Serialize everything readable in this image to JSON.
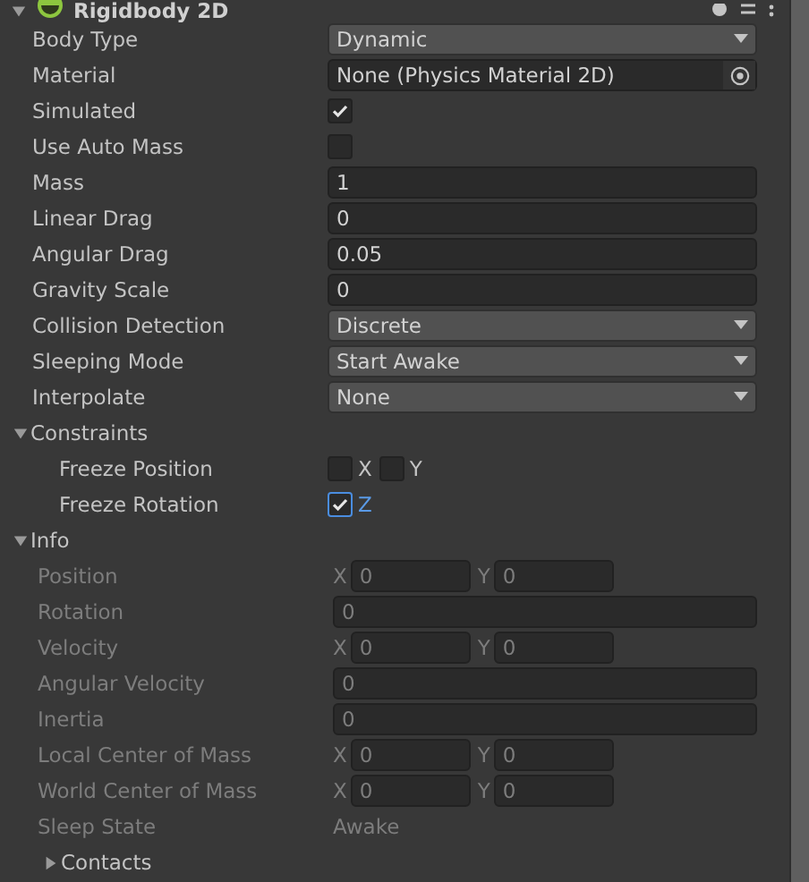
{
  "component": {
    "title": "Rigidbody 2D",
    "expanded": true
  },
  "properties": [
    {
      "kind": "dropdown",
      "label": "Body Type",
      "value": "Dynamic"
    },
    {
      "kind": "object",
      "label": "Material",
      "value": "None (Physics Material 2D)"
    },
    {
      "kind": "checkbox",
      "label": "Simulated",
      "checked": true
    },
    {
      "kind": "checkbox",
      "label": "Use Auto Mass",
      "checked": false
    },
    {
      "kind": "number",
      "label": "Mass",
      "value": "1"
    },
    {
      "kind": "number",
      "label": "Linear Drag",
      "value": "0"
    },
    {
      "kind": "number",
      "label": "Angular Drag",
      "value": "0.05"
    },
    {
      "kind": "number",
      "label": "Gravity Scale",
      "value": "0"
    },
    {
      "kind": "dropdown",
      "label": "Collision Detection",
      "value": "Discrete"
    },
    {
      "kind": "dropdown",
      "label": "Sleeping Mode",
      "value": "Start Awake"
    },
    {
      "kind": "dropdown",
      "label": "Interpolate",
      "value": "None"
    }
  ],
  "constraints": {
    "label": "Constraints",
    "expanded": true,
    "rows": [
      {
        "label": "Freeze Position",
        "axes": [
          {
            "axis": "X",
            "checked": false
          },
          {
            "axis": "Y",
            "checked": false
          }
        ]
      },
      {
        "label": "Freeze Rotation",
        "axes": [
          {
            "axis": "Z",
            "checked": true
          }
        ]
      }
    ]
  },
  "info": {
    "label": "Info",
    "expanded": true,
    "rows": [
      {
        "kind": "vector",
        "label": "Position",
        "fields": [
          {
            "axis": "X",
            "value": "0"
          },
          {
            "axis": "Y",
            "value": "0"
          }
        ]
      },
      {
        "kind": "number",
        "label": "Rotation",
        "value": "0"
      },
      {
        "kind": "vector",
        "label": "Velocity",
        "fields": [
          {
            "axis": "X",
            "value": "0"
          },
          {
            "axis": "Y",
            "value": "0"
          }
        ]
      },
      {
        "kind": "number",
        "label": "Angular Velocity",
        "value": "0"
      },
      {
        "kind": "number",
        "label": "Inertia",
        "value": "0"
      },
      {
        "kind": "vector",
        "label": "Local Center of Mass",
        "fields": [
          {
            "axis": "X",
            "value": "0"
          },
          {
            "axis": "Y",
            "value": "0"
          }
        ]
      },
      {
        "kind": "vector",
        "label": "World Center of Mass",
        "fields": [
          {
            "axis": "X",
            "value": "0"
          },
          {
            "axis": "Y",
            "value": "0"
          }
        ]
      },
      {
        "kind": "text",
        "label": "Sleep State",
        "value": "Awake"
      }
    ],
    "contacts": {
      "label": "Contacts",
      "expanded": false
    }
  }
}
